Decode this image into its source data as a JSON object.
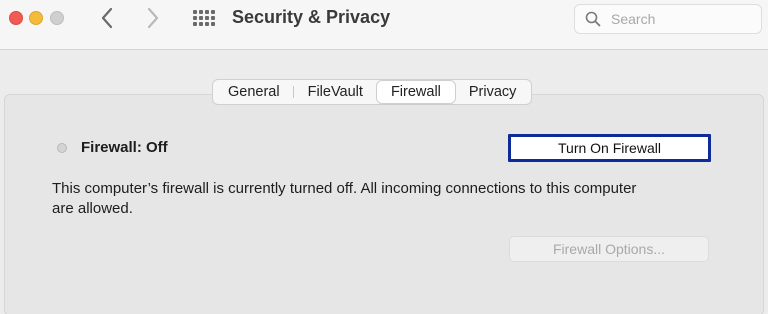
{
  "window": {
    "title": "Security & Privacy"
  },
  "search": {
    "placeholder": "Search",
    "value": ""
  },
  "tabs": [
    {
      "label": "General"
    },
    {
      "label": "FileVault"
    },
    {
      "label": "Firewall",
      "selected": true
    },
    {
      "label": "Privacy"
    }
  ],
  "firewall": {
    "status_label": "Firewall: Off",
    "turn_on_label": "Turn On Firewall",
    "description": "This computer’s firewall is currently turned off. All incoming connections to this computer are allowed.",
    "options_label": "Firewall Options..."
  },
  "icons": {
    "close": "close-icon",
    "minimize": "minimize-icon",
    "zoom": "zoom-icon",
    "back": "chevron-left-icon",
    "forward": "chevron-right-icon",
    "grid": "grid-icon",
    "search": "search-icon"
  },
  "colors": {
    "close": "#f15b53",
    "minimize": "#f4bb3a",
    "focus_ring": "#0f2a99"
  }
}
